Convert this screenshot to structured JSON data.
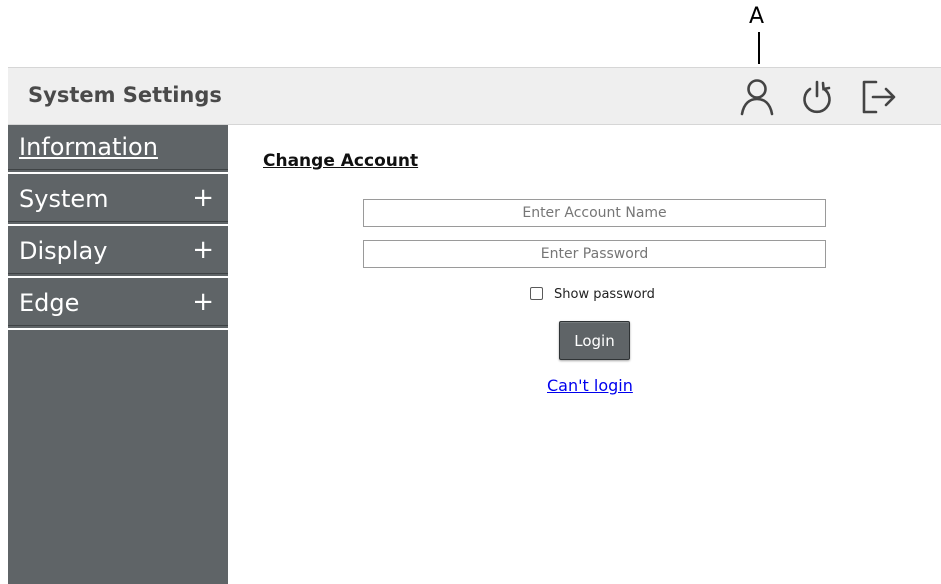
{
  "callout": {
    "label": "A"
  },
  "header": {
    "title": "System Settings",
    "icons": [
      "user-icon",
      "power-icon",
      "logout-icon"
    ]
  },
  "sidebar": {
    "items": [
      {
        "label": "Information",
        "expandable": false,
        "active": true
      },
      {
        "label": "System",
        "expandable": true,
        "toggle": "+"
      },
      {
        "label": "Display",
        "expandable": true,
        "toggle": "+"
      },
      {
        "label": "Edge",
        "expandable": true,
        "toggle": "+"
      }
    ]
  },
  "main": {
    "section_title": "Change Account",
    "account_field": {
      "placeholder": "Enter Account Name",
      "value": ""
    },
    "password_field": {
      "placeholder": "Enter Password",
      "value": ""
    },
    "show_password": {
      "label": "Show password",
      "checked": false
    },
    "login_button": "Login",
    "cant_login_link": "Can't login"
  },
  "colors": {
    "sidebar_bg": "#5f6467",
    "header_bg": "#efefef",
    "header_title": "#4a4a4a",
    "link": "#0000ee",
    "button_bg": "#5f6467"
  }
}
